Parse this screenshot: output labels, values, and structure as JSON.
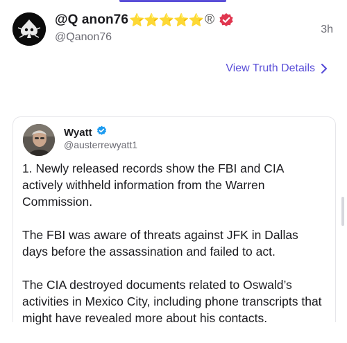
{
  "post": {
    "display_name": "@Q anon76",
    "stars": "⭐⭐⭐⭐⭐",
    "registered_mark": "®",
    "handle": "@Qanon76",
    "timestamp": "3h",
    "view_details": "View Truth Details"
  },
  "quoted": {
    "name": "Wyatt",
    "handle": "@austerrewyatt1",
    "paragraphs": [
      "1. Newly released records show the FBI and CIA actively withheld information from the Warren Commission.",
      "The FBI was aware of threats against JFK in Dallas days before the assassination and failed to act.",
      "The CIA destroyed documents related to Oswald’s activities in Mexico City, including phone transcripts that might have revealed more about his contacts."
    ]
  },
  "colors": {
    "accent": "#5a4fd8",
    "verified_red": "#e0364f",
    "verified_blue": "#1d9bf0",
    "star": "#f7c231"
  },
  "icons": {
    "chevron": "chevron-right-icon",
    "verified": "verified-badge-icon",
    "quoted_verified": "verified-check-icon"
  }
}
